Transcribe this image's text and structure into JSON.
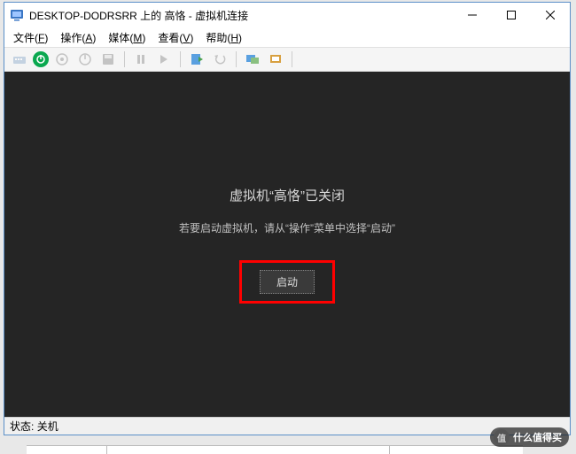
{
  "titlebar": {
    "title": "DESKTOP-DODRSRR 上的 高恪 - 虚拟机连接"
  },
  "menu": {
    "file": "文件(F)",
    "action": "操作(A)",
    "media": "媒体(M)",
    "view": "查看(V)",
    "help": "帮助(H)"
  },
  "toolbar_icons": {
    "ctrl_alt_del": "ctrl-alt-del",
    "power_on": "power-on",
    "power_off": "power-off",
    "shutdown": "shutdown",
    "save": "save",
    "pause": "pause",
    "reset": "reset",
    "checkpoint": "checkpoint",
    "revert": "revert",
    "enhanced": "enhanced",
    "share": "share"
  },
  "content": {
    "main_message": "虚拟机“高恪”已关闭",
    "sub_message": "若要启动虚拟机，请从“操作”菜单中选择“启动”",
    "start_button": "启动"
  },
  "statusbar": {
    "label": "状态:",
    "value": "关机"
  },
  "watermark": {
    "text": "什么值得买"
  }
}
